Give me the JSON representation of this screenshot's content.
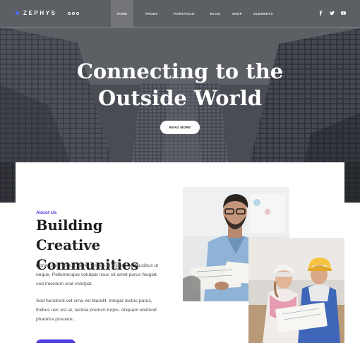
{
  "brand": {
    "name": "ZEPHYS",
    "accent": "#4c6bff"
  },
  "nav": {
    "items": [
      {
        "label": "HOME",
        "active": true
      },
      {
        "label": "PAGES",
        "active": false
      },
      {
        "label": "PORTFOLIO",
        "active": false
      },
      {
        "label": "BLOG",
        "active": false
      },
      {
        "label": "SHOP",
        "active": false
      },
      {
        "label": "ELEMENTS",
        "active": false
      }
    ],
    "menu_icon": "more-dots-icon",
    "socials": [
      "facebook-icon",
      "twitter-icon",
      "youtube-icon"
    ]
  },
  "hero": {
    "title_line1": "Connecting to the",
    "title_line2": "Outside World",
    "button_label": "READ MORE"
  },
  "about": {
    "eyebrow": "About Us",
    "title_line1": "Building Creative",
    "title_line2": "Communities",
    "paragraph1": "Donec accu lectus, pellentesque at dictum ac, faucibus ut neque. Pellentesque volutpat risus sit amet purus feugiat, sed interdum erat volutpat.",
    "paragraph2": "Sed hendrerit vel urna vel blandit. Integer lectus purus, finibus nec est at, lacinia pretium turpis. Aliquam eleifend pharetra posuere..",
    "accent": "#4c3ee0"
  }
}
